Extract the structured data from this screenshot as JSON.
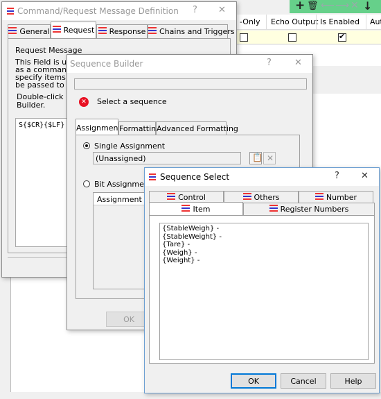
{
  "background_table": {
    "headers": [
      "-Only",
      "Echo Output",
      "Is Enabled",
      "Aut"
    ],
    "row_checks": [
      false,
      false,
      true
    ]
  },
  "toolbar_icons": [
    "add-icon",
    "delete-icon",
    "undo-icon",
    "redo-icon",
    "close-icon",
    "move-down-icon"
  ],
  "cmd_dialog": {
    "title": "Command/Request Message Definition",
    "help_glyph": "?",
    "close_glyph": "✕",
    "tabs": [
      "General",
      "Request",
      "Response",
      "Chains and Triggers"
    ],
    "active_tab": "Request",
    "section_label": "Request Message",
    "desc_lines": [
      "This Field is used",
      "as a command/ac",
      "specify items for w",
      "be passed to the d"
    ],
    "hint_lines": [
      "Double-click in d",
      "Builder."
    ],
    "message_value": "S{$CR}{$LF}"
  },
  "seq_builder": {
    "title": "Sequence Builder",
    "help_glyph": "?",
    "close_glyph": "✕",
    "status_text": "Select a sequence",
    "tabs": [
      "Assignments",
      "Formatting",
      "Advanced Formatting"
    ],
    "single_assignment_label": "Single Assignment",
    "single_assignment_value": "(Unassigned)",
    "bit_assignment_label": "Bit Assignment",
    "assignment_column": "Assignment",
    "ok_label": "OK"
  },
  "seq_select": {
    "title": "Sequence Select",
    "help_glyph": "?",
    "close_glyph": "✕",
    "tabs_row1": [
      "Control",
      "Others",
      "Number"
    ],
    "tabs_row2": [
      "Item",
      "Register Numbers"
    ],
    "active_tab": "Item",
    "items": [
      "{StableWeigh} -",
      "{StableWeight} -",
      "{Tare} -",
      "{Weigh} -",
      "{Weight} -"
    ],
    "ok_label": "OK",
    "cancel_label": "Cancel",
    "help_label": "Help"
  },
  "colors": {
    "toolbar_green": "#66d08a",
    "row_yellow": "#ffffe0",
    "error_red": "#e81123",
    "accent_blue": "#0078d7"
  }
}
